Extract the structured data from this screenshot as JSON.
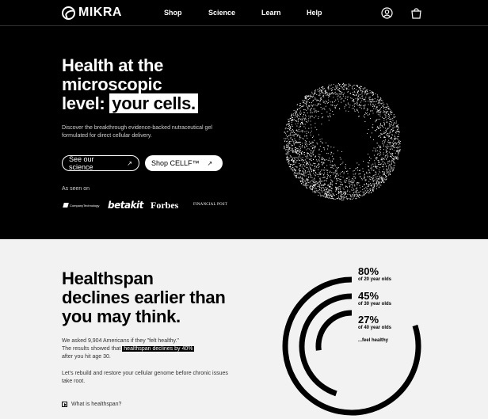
{
  "nav": {
    "brand": "MIKRA",
    "links": [
      "Shop",
      "Science",
      "Learn",
      "Help"
    ],
    "icons": [
      "account-icon",
      "cart-icon"
    ]
  },
  "hero": {
    "title_line1": "Health at the",
    "title_line2": "microscopic",
    "title_line3_prefix": "level:",
    "title_highlight": "your cells.",
    "description": "Discover the breakthrough evidence-backed nutraceutical gel formulated for direct cellular delivery.",
    "button_science": "See our science",
    "button_shop": "Shop CELLF™",
    "as_seen_on": "As seen on",
    "press": [
      "CompanyTechnology",
      "betakit",
      "Forbes",
      "FINANCIAL POST"
    ]
  },
  "healthspan": {
    "title_line1": "Healthspan",
    "title_line2": "declines earlier than",
    "title_line3": "you may think.",
    "p1_a": "We asked 9,904 Americans if they \"felt healthy.\"",
    "p1_b": "The results showed that",
    "p1_highlight": "healthspan declines by 40%",
    "p1_c": "after you hit age 30.",
    "p2": "Let's rebuild and restore your cellular genome before chronic issues take root.",
    "link": "What is healthspan?",
    "stats": [
      {
        "value": "80%",
        "label": "of 20 year olds",
        "fraction": 0.8
      },
      {
        "value": "45%",
        "label": "of 30 year olds",
        "fraction": 0.45
      },
      {
        "value": "27%",
        "label": "of 40 year olds",
        "fraction": 0.27
      }
    ],
    "feel": "...feel healthy"
  }
}
